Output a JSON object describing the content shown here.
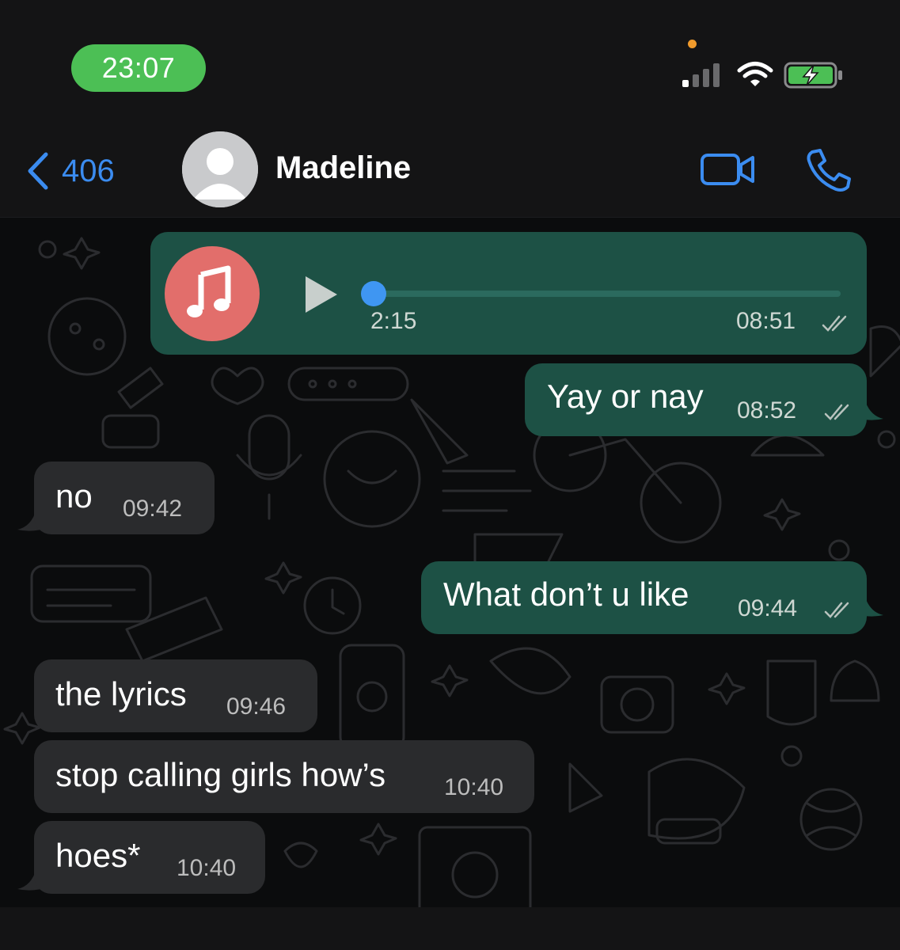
{
  "status_bar": {
    "time": "23:07"
  },
  "nav": {
    "back_count": "406",
    "contact_name": "Madeline",
    "icons": [
      "chevron-left-icon",
      "avatar-placeholder",
      "video-camera-icon",
      "phone-icon"
    ]
  },
  "colors": {
    "accent_blue": "#3b8cf0",
    "outgoing_bubble": "#1d5145",
    "incoming_bubble": "#2a2b2d",
    "status_pill": "#4cbf55",
    "music_icon_bg": "#e26e6b"
  },
  "messages": [
    {
      "type": "audio",
      "direction": "outgoing",
      "duration": "2:15",
      "time": "08:51",
      "status": "read"
    },
    {
      "type": "text",
      "direction": "outgoing",
      "text": "Yay or nay",
      "time": "08:52",
      "status": "read"
    },
    {
      "type": "text",
      "direction": "incoming",
      "text": "no",
      "time": "09:42"
    },
    {
      "type": "text",
      "direction": "outgoing",
      "text": "What don’t u like",
      "time": "09:44",
      "status": "read"
    },
    {
      "type": "text",
      "direction": "incoming",
      "text": "the lyrics",
      "time": "09:46"
    },
    {
      "type": "text",
      "direction": "incoming",
      "text": "stop calling girls how’s",
      "time": "10:40"
    },
    {
      "type": "text",
      "direction": "incoming",
      "text": "hoes*",
      "time": "10:40"
    }
  ]
}
